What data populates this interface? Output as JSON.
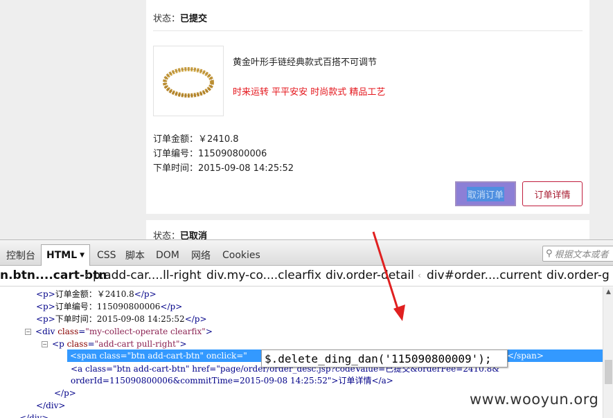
{
  "order": {
    "status_label": "状态：",
    "status_value": "已提交",
    "product_name": "黄金叶形手链经典款式百搭不可调节",
    "product_tags": "时来运转 平平安安 时尚款式 精品工艺",
    "amount": "订单金额：￥2410.8",
    "number": "订单编号：115090800006",
    "time": "下单时间：2015-09-08 14:25:52",
    "cancel_button": "取消订单",
    "detail_button": "订单详情"
  },
  "next_order": {
    "status_label": "状态：",
    "status_value": "已取消"
  },
  "devtools": {
    "tabs": [
      {
        "label": "控制台"
      },
      {
        "label": "HTML"
      },
      {
        "label": "CSS"
      },
      {
        "label": "脚本"
      },
      {
        "label": "DOM"
      },
      {
        "label": "网络"
      },
      {
        "label": "Cookies"
      }
    ],
    "search_placeholder": "根据文本或者",
    "breadcrumbs": [
      "n.btn....cart-btn",
      "p.add-car....ll-right",
      "div.my-co....clearfix",
      "div.order-detail",
      "div#order....current",
      "div.order-g"
    ],
    "tree": {
      "l1_text": "订单金额：￥2410.8",
      "l2_text": "订单编号：115090800006",
      "l3_text": "下单时间：2015-09-08 14:25:52",
      "l4_tag": "div",
      "l4_attr": "class",
      "l4_val": "\"my-collect-operate clearfix\"",
      "l5_tag": "p",
      "l5_attr": "class",
      "l5_val": "\"add-cart pull-right\"",
      "selected_line": "<span class=\"btn add-cart-btn\" onclick=\"",
      "selected_tail": "</span>",
      "a_line1": "<a class=\"btn add-cart-btn\" href=\"page/order/order_desc.jsp?codeValue=已提交&orderFee=2410.8&",
      "a_line2": "orderId=115090800006&commitTime=2015-09-08 14:25:52\">订单详情</a>",
      "close_p": "</p>",
      "close_div": "</div>",
      "close_div2": "</div>"
    },
    "tooltip": "$.delete_ding_dan('115090800009');"
  },
  "watermark": "www.wooyun.org"
}
